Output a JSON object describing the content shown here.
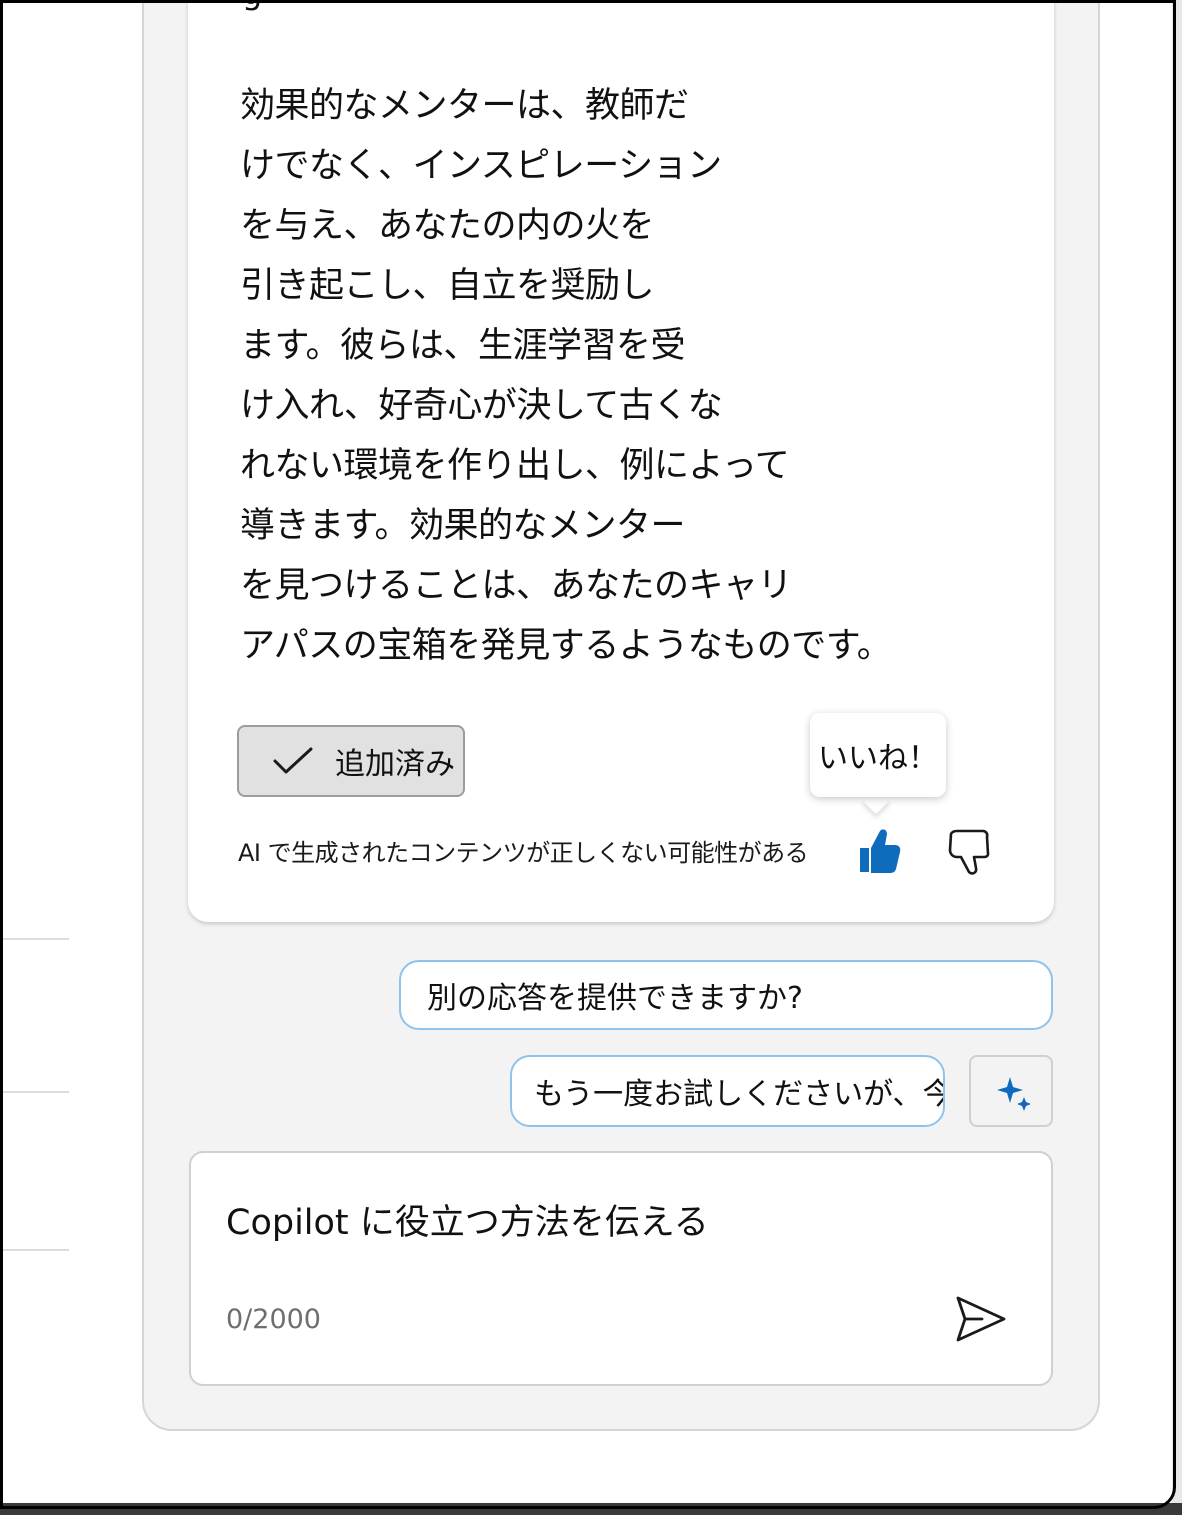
{
  "message": {
    "top_fragment": "g",
    "lines": [
      "効果的なメンターは、教師だ",
      "けでなく、インスピレーション",
      "を与え、あなたの内の火を",
      "引き起こし、自立を奨励し",
      "ます。彼らは、生涯学習を受",
      "け入れ、好奇心が決して古くな",
      "れない環境を作り出し、例によって",
      "導きます。効果的なメンター",
      "を見つけることは、あなたのキャリ",
      "アパスの宝箱を発見するようなものです。"
    ],
    "added_button_label": "追加済み",
    "added_icon": "checkmark-icon",
    "disclaimer": "AI で生成されたコンテンツが正しくない可能性がある",
    "tooltip": "いいね！",
    "like_icon": "thumbs-up-filled-icon",
    "dislike_icon": "thumbs-down-outline-icon",
    "like_color": "#0f6cbd"
  },
  "suggestions": [
    {
      "label": "別の応答を提供できますか?"
    },
    {
      "label": "もう一度お試しくださいが、今回は..."
    }
  ],
  "sparkle_icon": "sparkle-icon",
  "composer": {
    "placeholder": "Copilot に役立つ方法を伝える",
    "char_count": "0/2000",
    "send_icon": "send-icon"
  },
  "colors": {
    "accent": "#0f6cbd",
    "suggestion_border": "#8fc3ec",
    "panel_background": "#f3f3f3"
  }
}
